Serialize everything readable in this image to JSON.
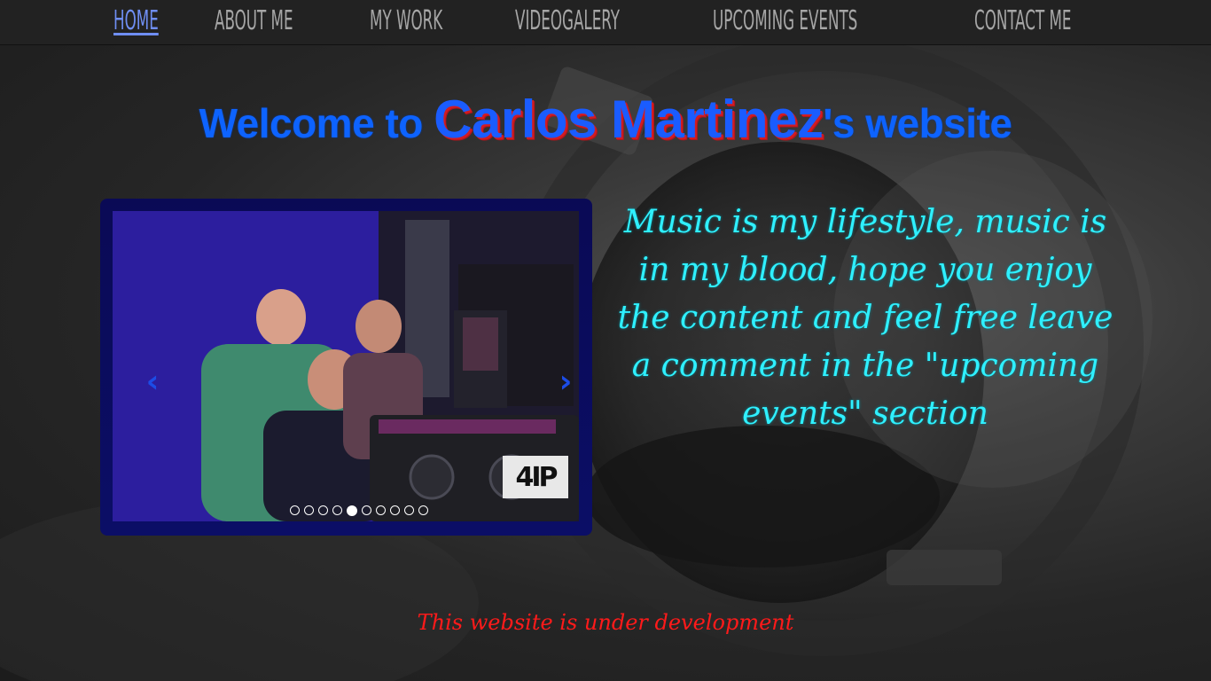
{
  "nav": {
    "items": [
      {
        "label": "Home",
        "active": true
      },
      {
        "label": "About me",
        "active": false
      },
      {
        "label": "My work",
        "active": false
      },
      {
        "label": "Videogalery",
        "active": false
      },
      {
        "label": "Upcoming events",
        "active": false
      },
      {
        "label": "Contact me",
        "active": false
      }
    ]
  },
  "heading": {
    "prefix": "Welcome to ",
    "name": "Carlos Martinez",
    "suffix": "'s website"
  },
  "carousel": {
    "prev_icon": "chevron-left-icon",
    "next_icon": "chevron-right-icon",
    "prev_symbol": "‹",
    "next_symbol": "›",
    "logo_text": "4IP",
    "indicator_count": 10,
    "active_index": 4
  },
  "tagline": "Music is my lifestyle, music is in my blood, hope you enjoy the content and feel free leave a comment in the \"upcoming events\" section",
  "notice": "This website is under development",
  "colors": {
    "nav_active": "#6f8ef3",
    "heading_blue": "#0d63ff",
    "name_shadow": "#d31b22",
    "tagline": "#2ff0ff",
    "notice": "#ff1a1a"
  }
}
